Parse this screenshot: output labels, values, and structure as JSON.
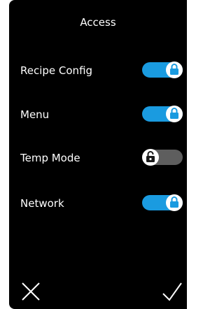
{
  "header": {
    "title": "Access"
  },
  "settings": [
    {
      "label": "Recipe Config",
      "state": "on",
      "lock": "locked"
    },
    {
      "label": "Menu",
      "state": "on",
      "lock": "locked"
    },
    {
      "label": "Temp Mode",
      "state": "off",
      "lock": "unlocked"
    },
    {
      "label": "Network",
      "state": "on",
      "lock": "locked"
    }
  ],
  "footer": {
    "cancel_icon": "close-icon",
    "confirm_icon": "checkmark-icon"
  },
  "colors": {
    "background": "#000000",
    "toggle_on": "#1a9be0",
    "toggle_off": "#5e5e5e",
    "knob": "#ffffff",
    "text": "#ffffff"
  }
}
